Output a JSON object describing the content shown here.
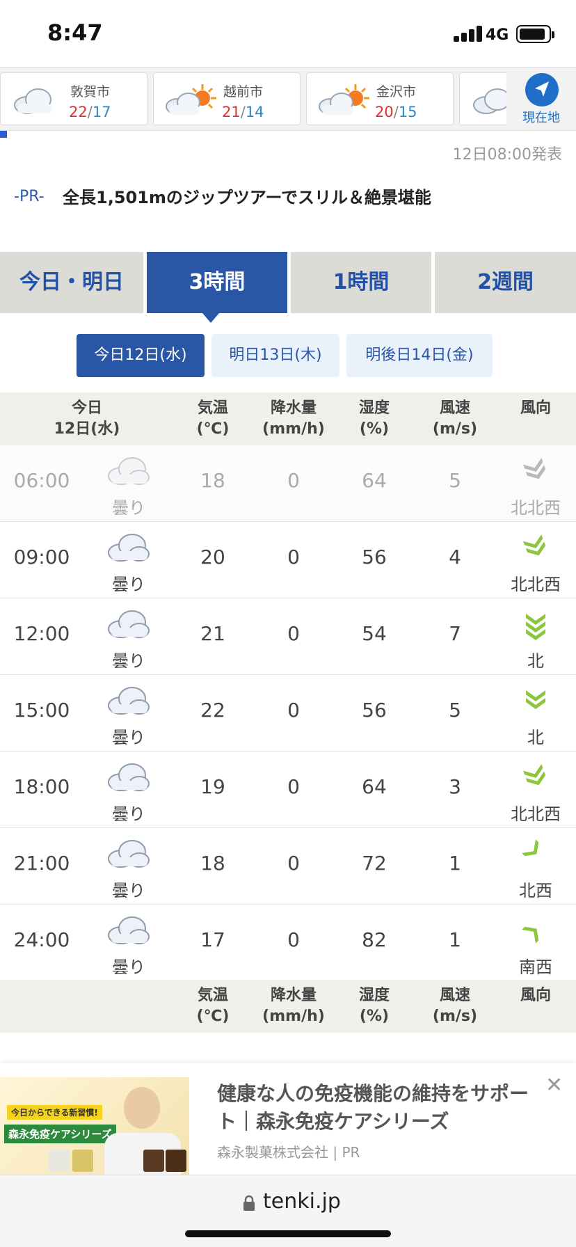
{
  "status_bar": {
    "time": "8:47",
    "network": "4G"
  },
  "cities": [
    {
      "name": "敦賀市",
      "high": "22",
      "low": "17",
      "icon": "cloudy-icon"
    },
    {
      "name": "越前市",
      "high": "21",
      "low": "14",
      "icon": "sun-cloud-icon"
    },
    {
      "name": "金沢市",
      "high": "20",
      "low": "15",
      "icon": "sun-cloud-icon"
    }
  ],
  "locate_label": "現在地",
  "issued": "12日08:00発表",
  "pr": {
    "tag": "-PR-",
    "headline": "全長1,501mのジップツアーでスリル＆絶景堪能"
  },
  "tabs": [
    {
      "label": "今日・明日",
      "active": false
    },
    {
      "label": "3時間",
      "active": true
    },
    {
      "label": "1時間",
      "active": false
    },
    {
      "label": "2週間",
      "active": false
    }
  ],
  "days": [
    {
      "label": "今日12日(水)",
      "active": true
    },
    {
      "label": "明日13日(木)",
      "active": false
    },
    {
      "label": "明後日14日(金)",
      "active": false
    }
  ],
  "table": {
    "header": {
      "day_line1": "今日",
      "day_line2": "12日(水)",
      "temp_line1": "気温",
      "temp_line2": "(℃)",
      "precip_line1": "降水量",
      "precip_line2": "(mm/h)",
      "humidity_line1": "湿度",
      "humidity_line2": "(%)",
      "wind_line1": "風速",
      "wind_line2": "(m/s)",
      "dir_line1": "風向"
    },
    "rows": [
      {
        "time": "06:00",
        "weather": "曇り",
        "temp": "18",
        "precip": "0",
        "humidity": "64",
        "wind": "5",
        "dir": "北北西",
        "past": true
      },
      {
        "time": "09:00",
        "weather": "曇り",
        "temp": "20",
        "precip": "0",
        "humidity": "56",
        "wind": "4",
        "dir": "北北西",
        "past": false
      },
      {
        "time": "12:00",
        "weather": "曇り",
        "temp": "21",
        "precip": "0",
        "humidity": "54",
        "wind": "7",
        "dir": "北",
        "past": false
      },
      {
        "time": "15:00",
        "weather": "曇り",
        "temp": "22",
        "precip": "0",
        "humidity": "56",
        "wind": "5",
        "dir": "北",
        "past": false
      },
      {
        "time": "18:00",
        "weather": "曇り",
        "temp": "19",
        "precip": "0",
        "humidity": "64",
        "wind": "3",
        "dir": "北北西",
        "past": false
      },
      {
        "time": "21:00",
        "weather": "曇り",
        "temp": "18",
        "precip": "0",
        "humidity": "72",
        "wind": "1",
        "dir": "北西",
        "past": false
      },
      {
        "time": "24:00",
        "weather": "曇り",
        "temp": "17",
        "precip": "0",
        "humidity": "82",
        "wind": "1",
        "dir": "南西",
        "past": false
      }
    ]
  },
  "ad": {
    "title": "健康な人の免疫機能の維持をサポート｜森永免疫ケアシリーズ",
    "sponsor": "森永製菓株式会社 | PR",
    "image_badge": "今日からできる新習慣!",
    "image_brand": "森永免疫ケアシリーズ"
  },
  "url": "tenki.jp",
  "colors": {
    "accent": "#2a56a6",
    "high": "#e03030",
    "low": "#2a8ac8",
    "wind_arrow": "#8cc63f"
  }
}
